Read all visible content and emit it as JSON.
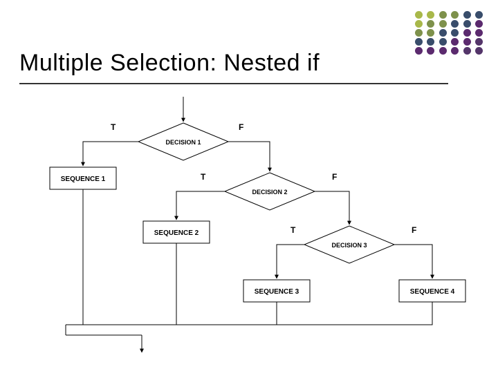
{
  "title": "Multiple Selection: Nested if",
  "labels": {
    "d1": "DECISION 1",
    "d2": "DECISION 2",
    "d3": "DECISION 3",
    "s1": "SEQUENCE 1",
    "s2": "SEQUENCE 2",
    "s3": "SEQUENCE 3",
    "s4": "SEQUENCE 4",
    "T": "T",
    "F": "F"
  },
  "chart_data": {
    "type": "flowchart",
    "nodes": [
      {
        "id": "d1",
        "kind": "decision",
        "label": "DECISION 1"
      },
      {
        "id": "s1",
        "kind": "process",
        "label": "SEQUENCE 1"
      },
      {
        "id": "d2",
        "kind": "decision",
        "label": "DECISION 2"
      },
      {
        "id": "s2",
        "kind": "process",
        "label": "SEQUENCE 2"
      },
      {
        "id": "d3",
        "kind": "decision",
        "label": "DECISION 3"
      },
      {
        "id": "s3",
        "kind": "process",
        "label": "SEQUENCE 3"
      },
      {
        "id": "s4",
        "kind": "process",
        "label": "SEQUENCE 4"
      }
    ],
    "edges": [
      {
        "from": "start",
        "to": "d1"
      },
      {
        "from": "d1",
        "to": "s1",
        "label": "T"
      },
      {
        "from": "d1",
        "to": "d2",
        "label": "F"
      },
      {
        "from": "d2",
        "to": "s2",
        "label": "T"
      },
      {
        "from": "d2",
        "to": "d3",
        "label": "F"
      },
      {
        "from": "d3",
        "to": "s3",
        "label": "T"
      },
      {
        "from": "d3",
        "to": "s4",
        "label": "F"
      },
      {
        "from": "s1",
        "to": "end"
      },
      {
        "from": "s2",
        "to": "end"
      },
      {
        "from": "s3",
        "to": "end"
      },
      {
        "from": "s4",
        "to": "end"
      }
    ]
  }
}
